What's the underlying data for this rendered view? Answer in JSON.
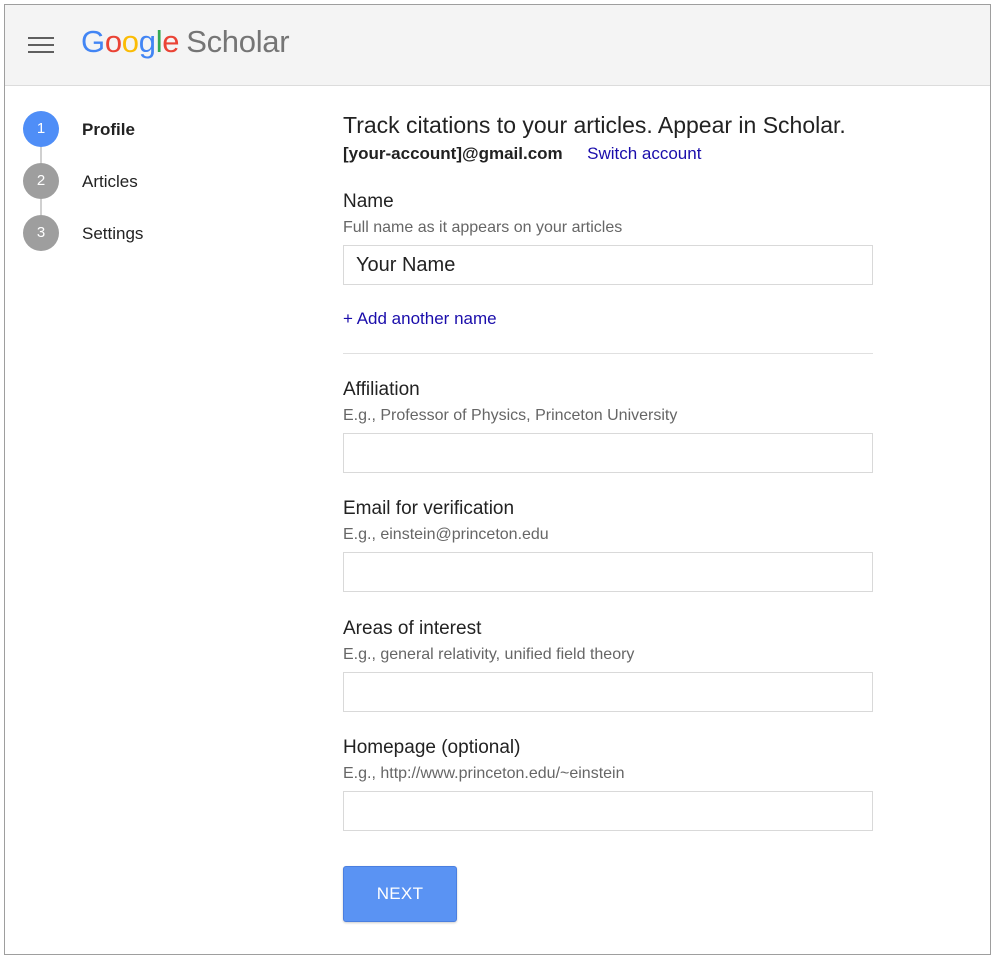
{
  "header": {
    "logo_letters": [
      "G",
      "o",
      "o",
      "g",
      "l",
      "e"
    ],
    "product_name": "Scholar"
  },
  "colors": {
    "logo_blue": "#4285f4",
    "logo_red": "#ea4335",
    "logo_yellow": "#fbbc05",
    "logo_green": "#34a853",
    "step_active": "#4f8ef7",
    "step_inactive": "#9e9e9e",
    "link": "#1a0dab",
    "button": "#5a93f3"
  },
  "steps": [
    {
      "number": "1",
      "label": "Profile",
      "active": true
    },
    {
      "number": "2",
      "label": "Articles",
      "active": false
    },
    {
      "number": "3",
      "label": "Settings",
      "active": false
    }
  ],
  "form": {
    "headline": "Track citations to your articles. Appear in Scholar.",
    "account_email": "[your-account]@gmail.com",
    "switch_account": "Switch account",
    "name": {
      "label": "Name",
      "hint": "Full name as it appears on your articles",
      "value": "Your Name"
    },
    "add_another_name": "+ Add another name",
    "affiliation": {
      "label": "Affiliation",
      "hint": "E.g., Professor of Physics, Princeton University",
      "value": ""
    },
    "email": {
      "label": "Email for verification",
      "hint": "E.g., einstein@princeton.edu",
      "value": ""
    },
    "interests": {
      "label": "Areas of interest",
      "hint": "E.g., general relativity, unified field theory",
      "value": ""
    },
    "homepage": {
      "label": "Homepage (optional)",
      "hint": "E.g., http://www.princeton.edu/~einstein",
      "value": ""
    },
    "next_label": "NEXT"
  }
}
